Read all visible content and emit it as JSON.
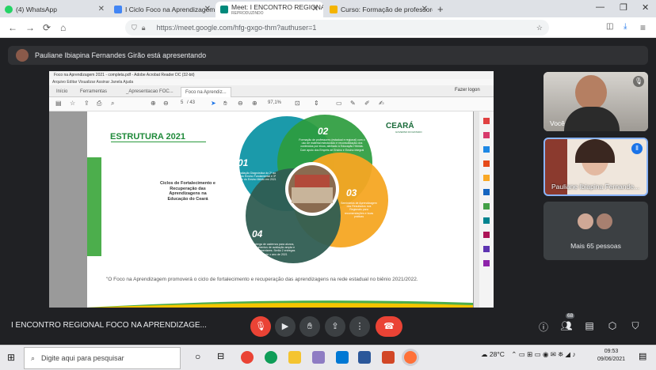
{
  "browser": {
    "tabs": [
      {
        "label": "(4) WhatsApp",
        "color": "#25d366"
      },
      {
        "label": "I Ciclo Foco na Aprendizagem",
        "color": "#4285f4"
      },
      {
        "label": "Meet: I ENCONTRO REGIONAL",
        "sub": "REPRODUZINDO",
        "color": "#00897b"
      },
      {
        "label": "Curso: Formação de professore",
        "color": "#f4b400"
      }
    ],
    "url": "https://meet.google.com/hfg-gxgo-thm?authuser=1"
  },
  "banner": {
    "text": "Pauliane Ibiapina Fernandes Girão está apresentando"
  },
  "acrobat": {
    "title": "Foco na Aprendizagem 2021 - completa.pdf - Adobe Acrobat Reader DC (32-bit)",
    "menu": "Arquivo   Editar   Visualizar   Assinar   Janela   Ajuda",
    "tabs": [
      "Início",
      "Ferramentas",
      "_Apresentacao FOC...",
      "Foco na Aprendiz..."
    ],
    "login": "Fazer logon",
    "page": "5",
    "total_pages": "/ 43",
    "zoom": "97,1%"
  },
  "slide": {
    "title": "ESTRUTURA 2021",
    "brand": "CEARÁ",
    "brand_sub": "GOVERNO DO ESTADO",
    "side_label": "Ciclos de Fortalecimento e Recuperação das Aprendizagens na Educação do Ceará",
    "circles": [
      {
        "num": "01",
        "text": "Avaliação Diagnóstica do 2º ao 9º do Ensino Fundamental e 3ª série do Ensino Médio em 2021",
        "color": "#1b9aaa"
      },
      {
        "num": "02",
        "text": "Formação de professores (estadual e regional) com o uso de material estruturado e reconsolidação dos conteúdos por eixos; alinhado à Educação Híbrida. Com apoio dos Emprés de Ensino e Ensino Integral",
        "color": "#2c9c3e"
      },
      {
        "num": "03",
        "text": "Seminários de Aprendizagem dos Resultados nos Regionais para recomendações e boas práticas",
        "color": "#f5a623"
      },
      {
        "num": "04",
        "text": "Entrega de cadernos para alunos, instrumentos de avaliação ampla e complementares. Serão 2 entregas durante o ano de 2021",
        "color": "#2f5d52"
      }
    ],
    "quote": "\"O Foco na Aprendizagem promoverá o ciclo de fortalecimento e recuperação das aprendizagens na rede estadual no biênio 2021/2022."
  },
  "participants": {
    "you": "Você",
    "presenter": "Pauliane Ibiapina Fernande...",
    "more": "Mais 65 pessoas"
  },
  "meeting": {
    "name": "I ENCONTRO REGIONAL FOCO NA APRENDIZAGE...",
    "participant_count": "68"
  },
  "taskbar": {
    "search_placeholder": "Digite aqui para pesquisar",
    "temperature": "28°C",
    "time": "09:53",
    "date": "09/06/2021"
  }
}
